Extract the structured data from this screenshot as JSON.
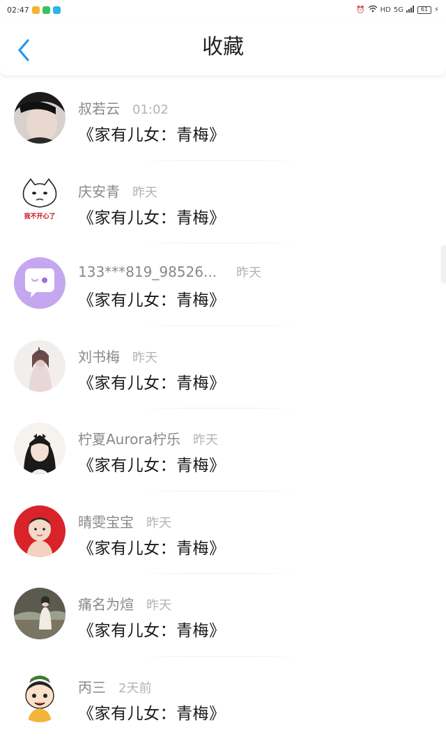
{
  "status_bar": {
    "time": "02:47",
    "battery": "61",
    "net_label": "5G"
  },
  "header": {
    "title": "收藏"
  },
  "items": [
    {
      "name": "叔若云",
      "time": "01:02",
      "content": "《家有儿女：青梅》",
      "avatar": "photo-dark-hair"
    },
    {
      "name": "庆安青",
      "time": "昨天",
      "content": "《家有儿女：青梅》",
      "avatar": "meme-cat",
      "avatar_caption": "我不开心了"
    },
    {
      "name": "133***819_98526...",
      "time": "昨天",
      "content": "《家有儿女：青梅》",
      "avatar": "chat-bubble-lavender"
    },
    {
      "name": "刘书梅",
      "time": "昨天",
      "content": "《家有儿女：青梅》",
      "avatar": "photo-light"
    },
    {
      "name": "柠夏Aurora柠乐",
      "time": "昨天",
      "content": "《家有儿女：青梅》",
      "avatar": "photo-girl"
    },
    {
      "name": "晴雯宝宝",
      "time": "昨天",
      "content": "《家有儿女：青梅》",
      "avatar": "photo-baby-red"
    },
    {
      "name": "痛名为煊",
      "time": "昨天",
      "content": "《家有儿女：青梅》",
      "avatar": "photo-outdoor"
    },
    {
      "name": "丙三",
      "time": "2天前",
      "content": "《家有儿女：青梅》",
      "avatar": "cartoon-boy"
    }
  ],
  "colors": {
    "accent": "#2196f3",
    "name_gray": "#888888",
    "time_gray": "#b3b3b3",
    "lavender": "#c5a7f0"
  }
}
